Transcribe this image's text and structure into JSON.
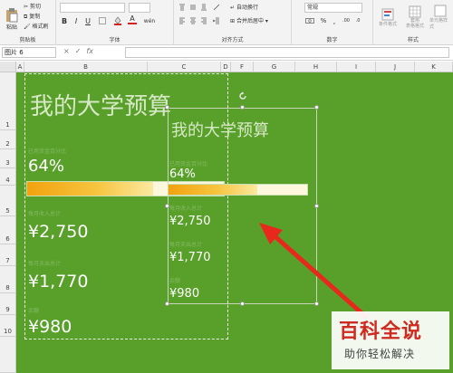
{
  "ribbon": {
    "clipboard": {
      "paste": "粘贴",
      "cut": "剪切",
      "copy": "复制",
      "format_painter": "格式刷",
      "group": "剪贴板"
    },
    "font": {
      "bold": "B",
      "italic": "I",
      "underline": "U",
      "font_color": "A",
      "wen": "wén",
      "group": "字体"
    },
    "alignment": {
      "wrap": "自动换行",
      "merge": "合并后居中",
      "group": "对齐方式"
    },
    "number": {
      "format": "常规",
      "percent": "%",
      "comma": ",",
      "group": "数字"
    },
    "styles": {
      "conditional": "条件格式",
      "table_format": "套用\n表格格式",
      "cell_styles": "单元格样式",
      "group": "样式"
    }
  },
  "formula_bar": {
    "name_box": "图片 6",
    "cancel": "×",
    "enter": "✓",
    "fx": "fx",
    "value": ""
  },
  "sheet": {
    "columns": [
      "A",
      "B",
      "C",
      "D",
      "F",
      "G",
      "H",
      "I",
      "J",
      "K"
    ],
    "rows": [
      "1",
      "2",
      "3",
      "4",
      "5",
      "6",
      "7",
      "8",
      "9",
      "10"
    ]
  },
  "left_card": {
    "title": "我的大学预算",
    "pct_caption": "已用资金百分比",
    "pct_value": "64%",
    "progress": 0.64,
    "label1": "每月收入总计",
    "value1": "¥2,750",
    "label2": "每月支出总计",
    "value2": "¥1,770",
    "label3": "余额",
    "value3": "¥980"
  },
  "right_card": {
    "title": "我的大学预算",
    "pct_caption": "已用资金百分比",
    "pct_value": "64%",
    "progress": 0.64,
    "label1": "每月收入总计",
    "value1": "¥2,750",
    "label2": "每月支出总计",
    "value2": "¥1,770",
    "label3": "余额",
    "value3": "¥980"
  },
  "watermark": {
    "main": "百科全说",
    "sub": "助你轻松解决"
  },
  "colors": {
    "sheet_bg": "#59a02b",
    "bar_fill": "#f2a20f",
    "watermark_red": "#cf2a1f"
  }
}
